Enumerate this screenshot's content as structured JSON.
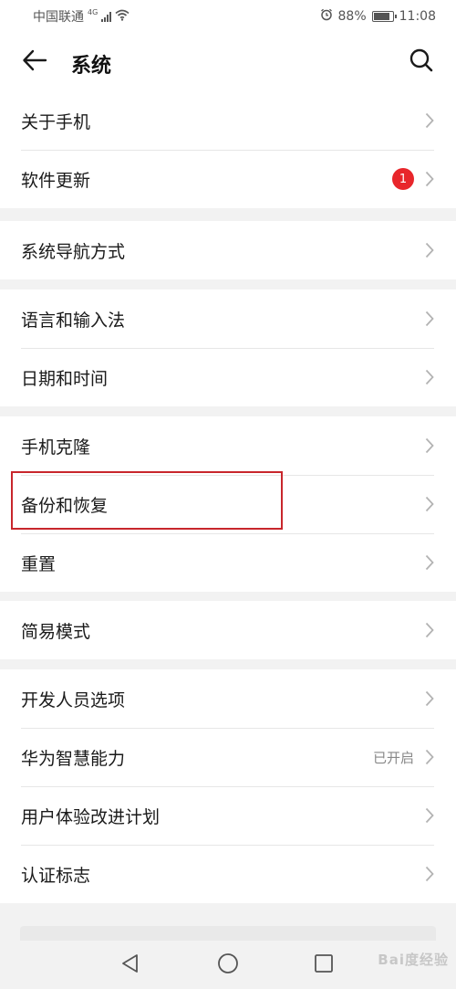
{
  "status_bar": {
    "carrier": "中国联通",
    "network": "4G",
    "battery": "88%",
    "time": "11:08"
  },
  "header": {
    "title": "系统"
  },
  "sections": [
    {
      "items": [
        {
          "label": "关于手机"
        },
        {
          "label": "软件更新",
          "badge": "1"
        }
      ]
    },
    {
      "items": [
        {
          "label": "系统导航方式"
        }
      ]
    },
    {
      "items": [
        {
          "label": "语言和输入法"
        },
        {
          "label": "日期和时间"
        }
      ]
    },
    {
      "items": [
        {
          "label": "手机克隆"
        },
        {
          "label": "备份和恢复"
        },
        {
          "label": "重置"
        }
      ]
    },
    {
      "items": [
        {
          "label": "简易模式"
        }
      ]
    },
    {
      "items": [
        {
          "label": "开发人员选项"
        },
        {
          "label": "华为智慧能力",
          "value": "已开启"
        },
        {
          "label": "用户体验改进计划"
        },
        {
          "label": "认证标志"
        }
      ]
    }
  ],
  "colors": {
    "badge": "#e8262b",
    "highlight_border": "#c8262c",
    "background": "#f2f2f2"
  },
  "icons": [
    "back-arrow-icon",
    "search-icon",
    "chevron-right-icon",
    "nav-back-icon",
    "nav-home-icon",
    "nav-recents-icon"
  ],
  "watermark": "Bai度经验"
}
